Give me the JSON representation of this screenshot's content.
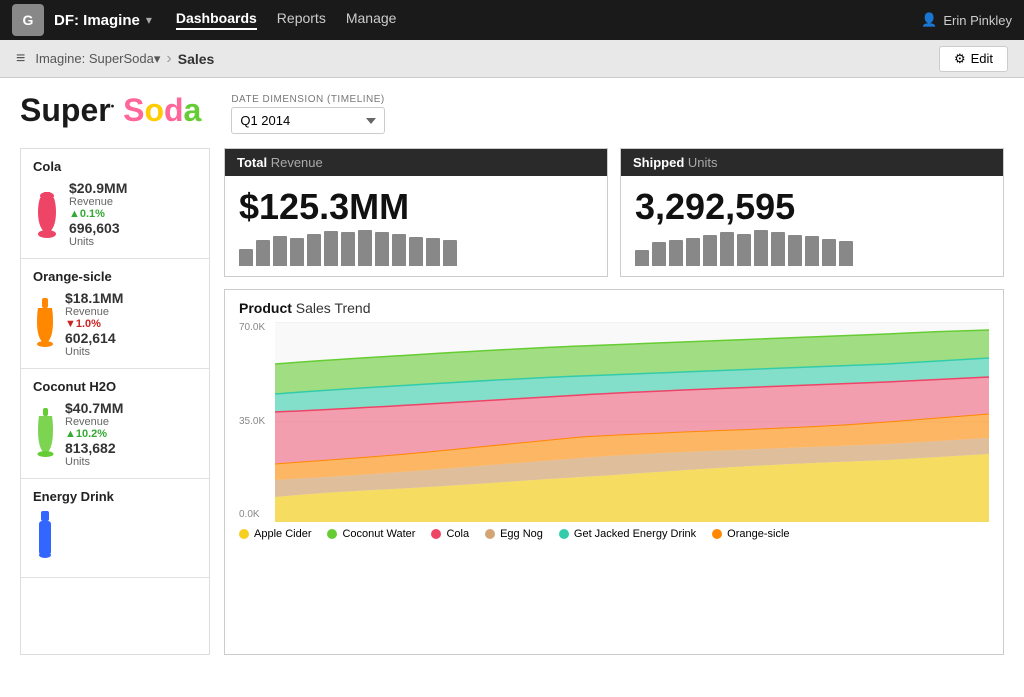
{
  "nav": {
    "logo_text": "G",
    "brand": "DF: Imagine",
    "links": [
      {
        "label": "Dashboards",
        "active": true
      },
      {
        "label": "Reports",
        "active": false
      },
      {
        "label": "Manage",
        "active": false
      }
    ],
    "user_icon": "👤",
    "user_name": "Erin Pinkley"
  },
  "breadcrumb": {
    "menu_icon": "≡",
    "path": "Imagine: SuperSoda",
    "dropdown": "▾",
    "current": "Sales",
    "edit_icon": "⚙",
    "edit_label": "Edit"
  },
  "logo": {
    "super": "Super",
    "soda": "Soda"
  },
  "date_filter": {
    "label": "DATE DIMENSION (TIMELINE)",
    "value": "Q1 2014"
  },
  "products": [
    {
      "name": "Cola",
      "revenue": "$20.9MM",
      "rev_label": "Revenue",
      "change": "▲0.1%",
      "change_dir": "up",
      "units": "696,603",
      "units_label": "Units",
      "color": "#ee4466"
    },
    {
      "name": "Orange-sicle",
      "revenue": "$18.1MM",
      "rev_label": "Revenue",
      "change": "▼1.0%",
      "change_dir": "down",
      "units": "602,614",
      "units_label": "Units",
      "color": "#ff8800"
    },
    {
      "name": "Coconut H2O",
      "revenue": "$40.7MM",
      "rev_label": "Revenue",
      "change": "▲10.2%",
      "change_dir": "up",
      "units": "813,682",
      "units_label": "Units",
      "color": "#66cc33"
    },
    {
      "name": "Energy Drink",
      "revenue": "",
      "rev_label": "",
      "change": "",
      "change_dir": "up",
      "units": "",
      "units_label": "",
      "color": "#3366ff"
    }
  ],
  "kpi_revenue": {
    "header_bold": "Total",
    "header_light": " Revenue",
    "value": "$125.3MM",
    "bars": [
      30,
      45,
      52,
      48,
      55,
      60,
      58,
      62,
      58,
      55,
      50,
      48,
      44
    ]
  },
  "kpi_units": {
    "header_bold": "Shipped",
    "header_light": " Units",
    "value": "3,292,595",
    "bars": [
      25,
      38,
      42,
      45,
      50,
      55,
      52,
      58,
      55,
      50,
      48,
      44,
      40
    ]
  },
  "trend": {
    "title_bold": "Product",
    "title_light": " Sales Trend",
    "y_labels": [
      "70.0K",
      "35.0K",
      "0.0K"
    ],
    "legend": [
      {
        "label": "Apple Cider",
        "color": "#f5d020"
      },
      {
        "label": "Coconut Water",
        "color": "#66cc33"
      },
      {
        "label": "Cola",
        "color": "#ee4466"
      },
      {
        "label": "Egg Nog",
        "color": "#d4a574"
      },
      {
        "label": "Get Jacked Energy Drink",
        "color": "#33ccaa"
      },
      {
        "label": "Orange-sicle",
        "color": "#ff8800"
      }
    ]
  }
}
